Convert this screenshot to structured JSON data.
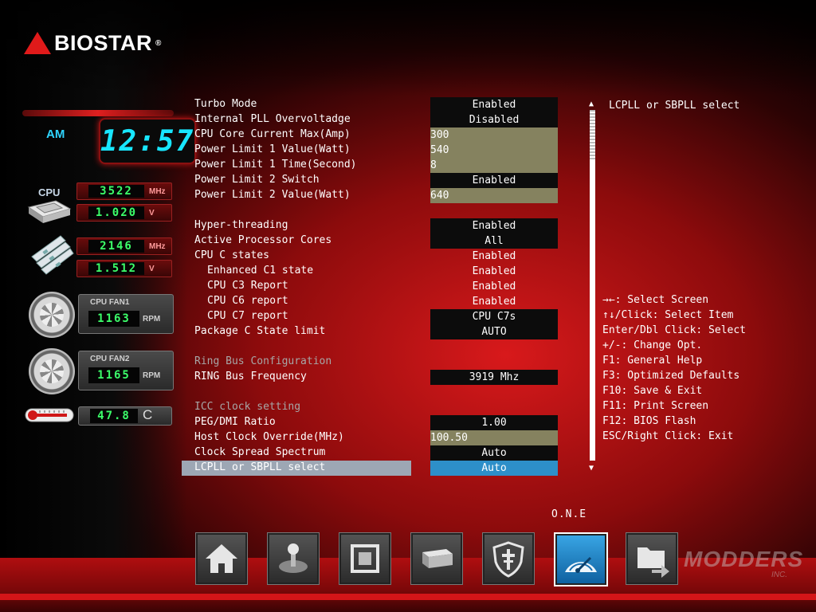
{
  "brand": {
    "name": "BIOSTAR",
    "reg": "®"
  },
  "clock": {
    "ampm": "AM",
    "time": "12:57"
  },
  "monitor": {
    "cpu_label": "CPU",
    "cpu_freq": "3522",
    "cpu_freq_unit": "MHz",
    "cpu_volt": "1.020",
    "cpu_volt_unit": "V",
    "mem_freq": "2146",
    "mem_freq_unit": "MHz",
    "mem_volt": "1.512",
    "mem_volt_unit": "V",
    "fan1_label": "CPU FAN1",
    "fan1_rpm": "1163",
    "fan1_unit": "RPM",
    "fan2_label": "CPU FAN2",
    "fan2_rpm": "1165",
    "fan2_unit": "RPM",
    "temp": "47.8",
    "temp_unit": "C"
  },
  "settings": [
    {
      "label": "Turbo Mode",
      "value": "Enabled",
      "kind": "option"
    },
    {
      "label": "Internal PLL Overvoltadge",
      "value": "Disabled",
      "kind": "option"
    },
    {
      "label": "CPU Core Current Max(Amp)",
      "value": "300",
      "kind": "input"
    },
    {
      "label": "Power Limit 1 Value(Watt)",
      "value": "540",
      "kind": "input"
    },
    {
      "label": "Power Limit 1 Time(Second)",
      "value": "8",
      "kind": "input"
    },
    {
      "label": "Power Limit 2 Switch",
      "value": "Enabled",
      "kind": "option"
    },
    {
      "label": "Power Limit 2 Value(Watt)",
      "value": "640",
      "kind": "input"
    },
    {
      "label": "Hyper-threading",
      "value": "Enabled",
      "kind": "option"
    },
    {
      "label": "Active Processor Cores",
      "value": "All",
      "kind": "option"
    },
    {
      "label": "CPU C states",
      "value": "Enabled",
      "kind": "option"
    },
    {
      "label": "Enhanced C1 state",
      "value": "Enabled",
      "kind": "option"
    },
    {
      "label": "CPU C3 Report",
      "value": "Enabled",
      "kind": "option"
    },
    {
      "label": "CPU C6 report",
      "value": "Enabled",
      "kind": "option"
    },
    {
      "label": "CPU C7 report",
      "value": "CPU C7s",
      "kind": "option"
    },
    {
      "label": "Package C State limit",
      "value": "AUTO",
      "kind": "option"
    },
    {
      "label": "Ring Bus Configuration",
      "value": "",
      "kind": "header"
    },
    {
      "label": "RING Bus Frequency",
      "value": "3919 Mhz",
      "kind": "option"
    },
    {
      "label": "ICC clock setting",
      "value": "",
      "kind": "header"
    },
    {
      "label": "PEG/DMI Ratio",
      "value": "1.00",
      "kind": "option"
    },
    {
      "label": "Host Clock Override(MHz)",
      "value": "100.50",
      "kind": "input"
    },
    {
      "label": "Clock Spread Spectrum",
      "value": "Auto",
      "kind": "option"
    },
    {
      "label": "LCPLL or SBPLL select",
      "value": "Auto",
      "kind": "selected"
    }
  ],
  "help": {
    "title": "LCPLL or SBPLL select",
    "keys": [
      "→←: Select Screen",
      "↑↓/Click: Select Item",
      "Enter/Dbl Click: Select",
      "+/-: Change Opt.",
      "F1: General Help",
      "F3: Optimized Defaults",
      "F10: Save & Exit",
      "F11: Print Screen",
      "F12: BIOS Flash",
      "ESC/Right Click: Exit"
    ]
  },
  "scroll": {
    "up": "▲",
    "down": "▼"
  },
  "bottom_nav": {
    "active_label": "O.N.E",
    "items": [
      "home-icon",
      "joystick-icon",
      "chip-icon",
      "storage-icon",
      "shield-icon",
      "speedometer-icon",
      "exit-folder-icon"
    ]
  },
  "watermark": {
    "main": "MODDERS",
    "sub": "INC."
  }
}
